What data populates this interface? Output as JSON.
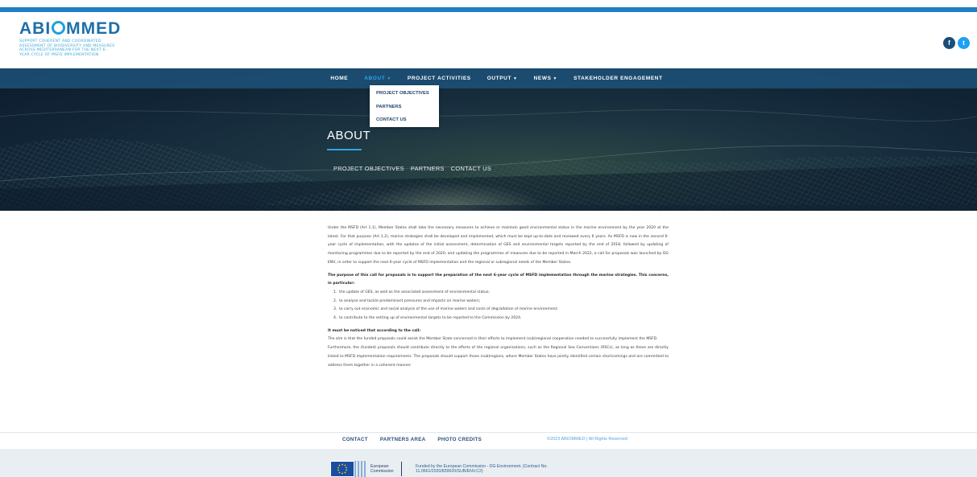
{
  "brand": {
    "logo_text_1": "ABI",
    "logo_text_2": "MMED",
    "tagline": "SUPPORT COHERENT AND COORDINATED ASSESSMENT OF BIODIVERSITY AND MEASURES ACROSS MEDITERRANEAN FOR THE NEXT 6-YEAR CYCLE OF MSFD IMPLEMENTATION",
    "accent": "#1f7fc4"
  },
  "social": {
    "facebook_glyph": "f",
    "twitter_glyph": "t"
  },
  "nav": {
    "items": [
      {
        "label": "HOME",
        "has_caret": false
      },
      {
        "label": "ABOUT",
        "has_caret": true
      },
      {
        "label": "PROJECT ACTIVITIES",
        "has_caret": false
      },
      {
        "label": "OUTPUT",
        "has_caret": true
      },
      {
        "label": "NEWS",
        "has_caret": true
      },
      {
        "label": "STAKEHOLDER ENGAGEMENT",
        "has_caret": false
      }
    ],
    "caret": "▼",
    "dropdown": [
      "PROJECT OBJECTIVES",
      "PARTNERS",
      "CONTACT US"
    ]
  },
  "hero": {
    "title": "ABOUT",
    "links": [
      "PROJECT OBJECTIVES",
      "PARTNERS",
      "CONTACT US"
    ]
  },
  "content": {
    "intro": "Under the MSFD (Art 1.1), Member States shall take the necessary measures to achieve or maintain good environmental status in the marine environment by the year 2020 at the latest. For that purpose (Art 1.2), marine strategies shall be developed and implemented, which must be kept up-to-date and reviewed every 6 years. As MSFD is now in the second 6-year cycle of implementation, with the updates of the initial assessment, determination of GES and environmental targets reported by the end of 2018, followed by updating of monitoring programmes due to be reported by the end of 2020, and updating the programmes of measures due to be reported in March 2022, a call for proposals was launched by DG ENV, in order to support the next 6-year cycle of MSFD implementation and the regional or subregional needs of the Member States.",
    "purpose": "The purpose of this call for proposals is to support the preparation of the next 6-year cycle of MSFD implementation through the marine strategies. This concerns, in particular:",
    "list": [
      {
        "num": "1.",
        "text": "the update of GES, as well as the associated assessment of environmental status;"
      },
      {
        "num": "2.",
        "text": "to analyse and tackle predominant pressures and impacts on marine waters;"
      },
      {
        "num": "3.",
        "text": "to carry out economic and social analysis of the use of marine waters and costs of degradation of marine environment;"
      },
      {
        "num": "4.",
        "text": "to contribute to the setting up of environmental targets to be reported to the Commission by 2024."
      }
    ],
    "notice_heading": "It must be noticed that according to the call:",
    "aim": "The aim is that the funded proposals could assist the Member State concerned in their efforts to implement (sub)regional cooperation needed to successfully implement the MSFD.",
    "furthermore": "Furthermore, the (funded) proposals should contribute directly to the efforts of the regional organisations, such as the Regional Sea Conventions (RSCs), as long as these are directly linked to MSFD implementation requirements. The proposals should support those (sub)regions, where Member States have jointly identified certain shortcomings and are committed to address them together in a coherent manner."
  },
  "footer": {
    "links": [
      "CONTACT",
      "PARTNERS AREA",
      "PHOTO CREDITS"
    ],
    "copyright": "©2023 ABIOMMED | All Rights Reserved",
    "eu_line1": "European",
    "eu_line2": "Commission",
    "funded_line1": "Funded by the European Commission - DG Environment. (Contract No.",
    "funded_line2": "11.0661/2020/839620/SUB/ENV.C2)"
  }
}
